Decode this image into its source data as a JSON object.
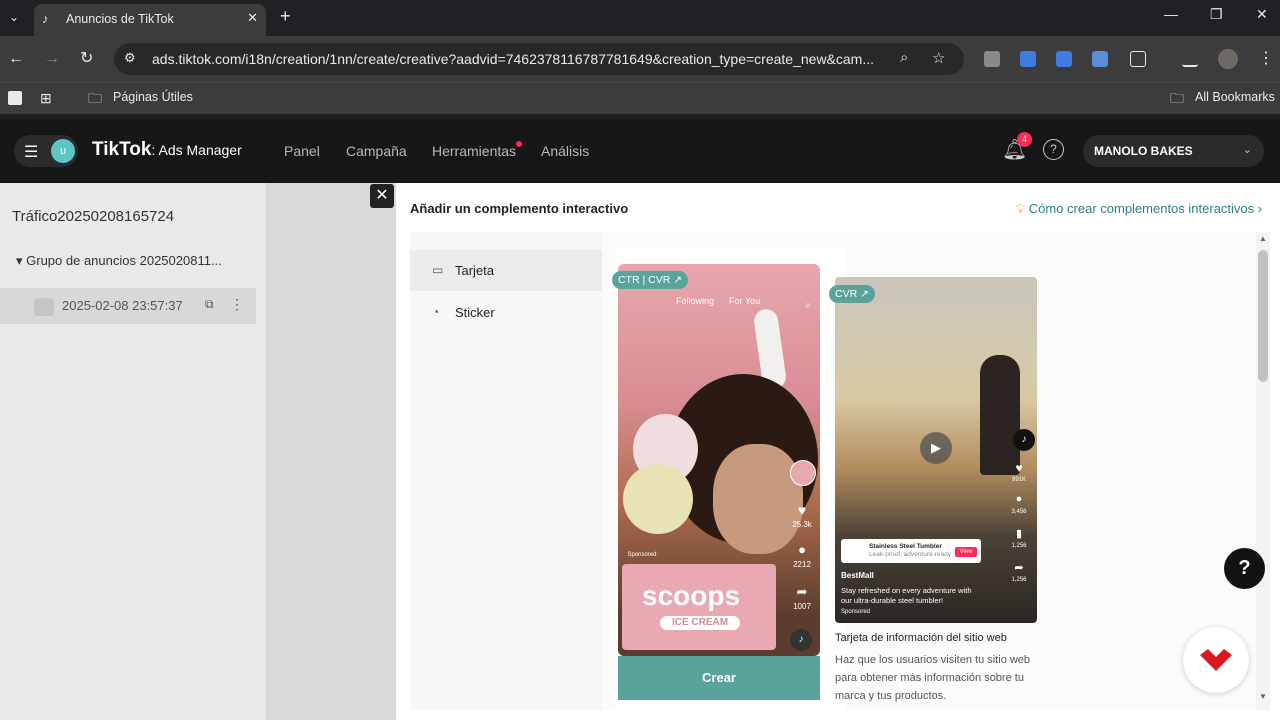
{
  "browser": {
    "tab_title": "Anuncios de TikTok",
    "url": "ads.tiktok.com/i18n/creation/1nn/create/creative?aadvid=7462378116787781649&creation_type=create_new&cam...",
    "bookmark_folder": "Páginas Útiles",
    "all_bookmarks": "All Bookmarks"
  },
  "header": {
    "avatar_letter": "u",
    "brand_main": "TikTok",
    "brand_sub": ": Ads Manager",
    "nav": [
      "Panel",
      "Campaña",
      "Herramientas",
      "Análisis"
    ],
    "notification_count": "4",
    "account_name": "MANOLO BAKES"
  },
  "left_panel": {
    "campaign": "Tráfico20250208165724",
    "ad_group": "Grupo de anuncios 2025020811...",
    "ad": "2025-02-08 23:57:37"
  },
  "modal": {
    "title": "Añadir un complemento interactivo",
    "help_link": "Cómo crear complementos interactivos",
    "sidebar": [
      {
        "label": "Tarjeta"
      },
      {
        "label": "Sticker"
      }
    ],
    "card1": {
      "tag": "CTR | CVR ↗",
      "phone_top_following": "Following",
      "phone_top_foryou": "For You",
      "scoops": "scoops",
      "scoops_sub": "ICE CREAM",
      "likes": "25.3k",
      "comments": "2212",
      "shares": "1007",
      "sponsored": "Sponsored",
      "button": "Crear"
    },
    "card2": {
      "tag": "CVR ↗",
      "product": "Stainless Steel Tumbler",
      "product_sub": "Leak-proof, adventure-ready",
      "view": "View",
      "shop": "BestMall",
      "caption1": "Stay refreshed on every adventure with",
      "caption2": "our ultra-durable steel tumbler!",
      "sponsored": "Sponsored",
      "likes": "991K",
      "comments": "3,456",
      "saves": "1,256",
      "shares": "1,256",
      "title": "Tarjeta de información del sitio web",
      "description": "Haz que los usuarios visiten tu sitio web para obtener más información sobre tu marca y tus productos."
    }
  },
  "colors": {
    "accent": "#5aa39a",
    "tiktok_red": "#fe2c55",
    "link": "#2d7f7f"
  }
}
